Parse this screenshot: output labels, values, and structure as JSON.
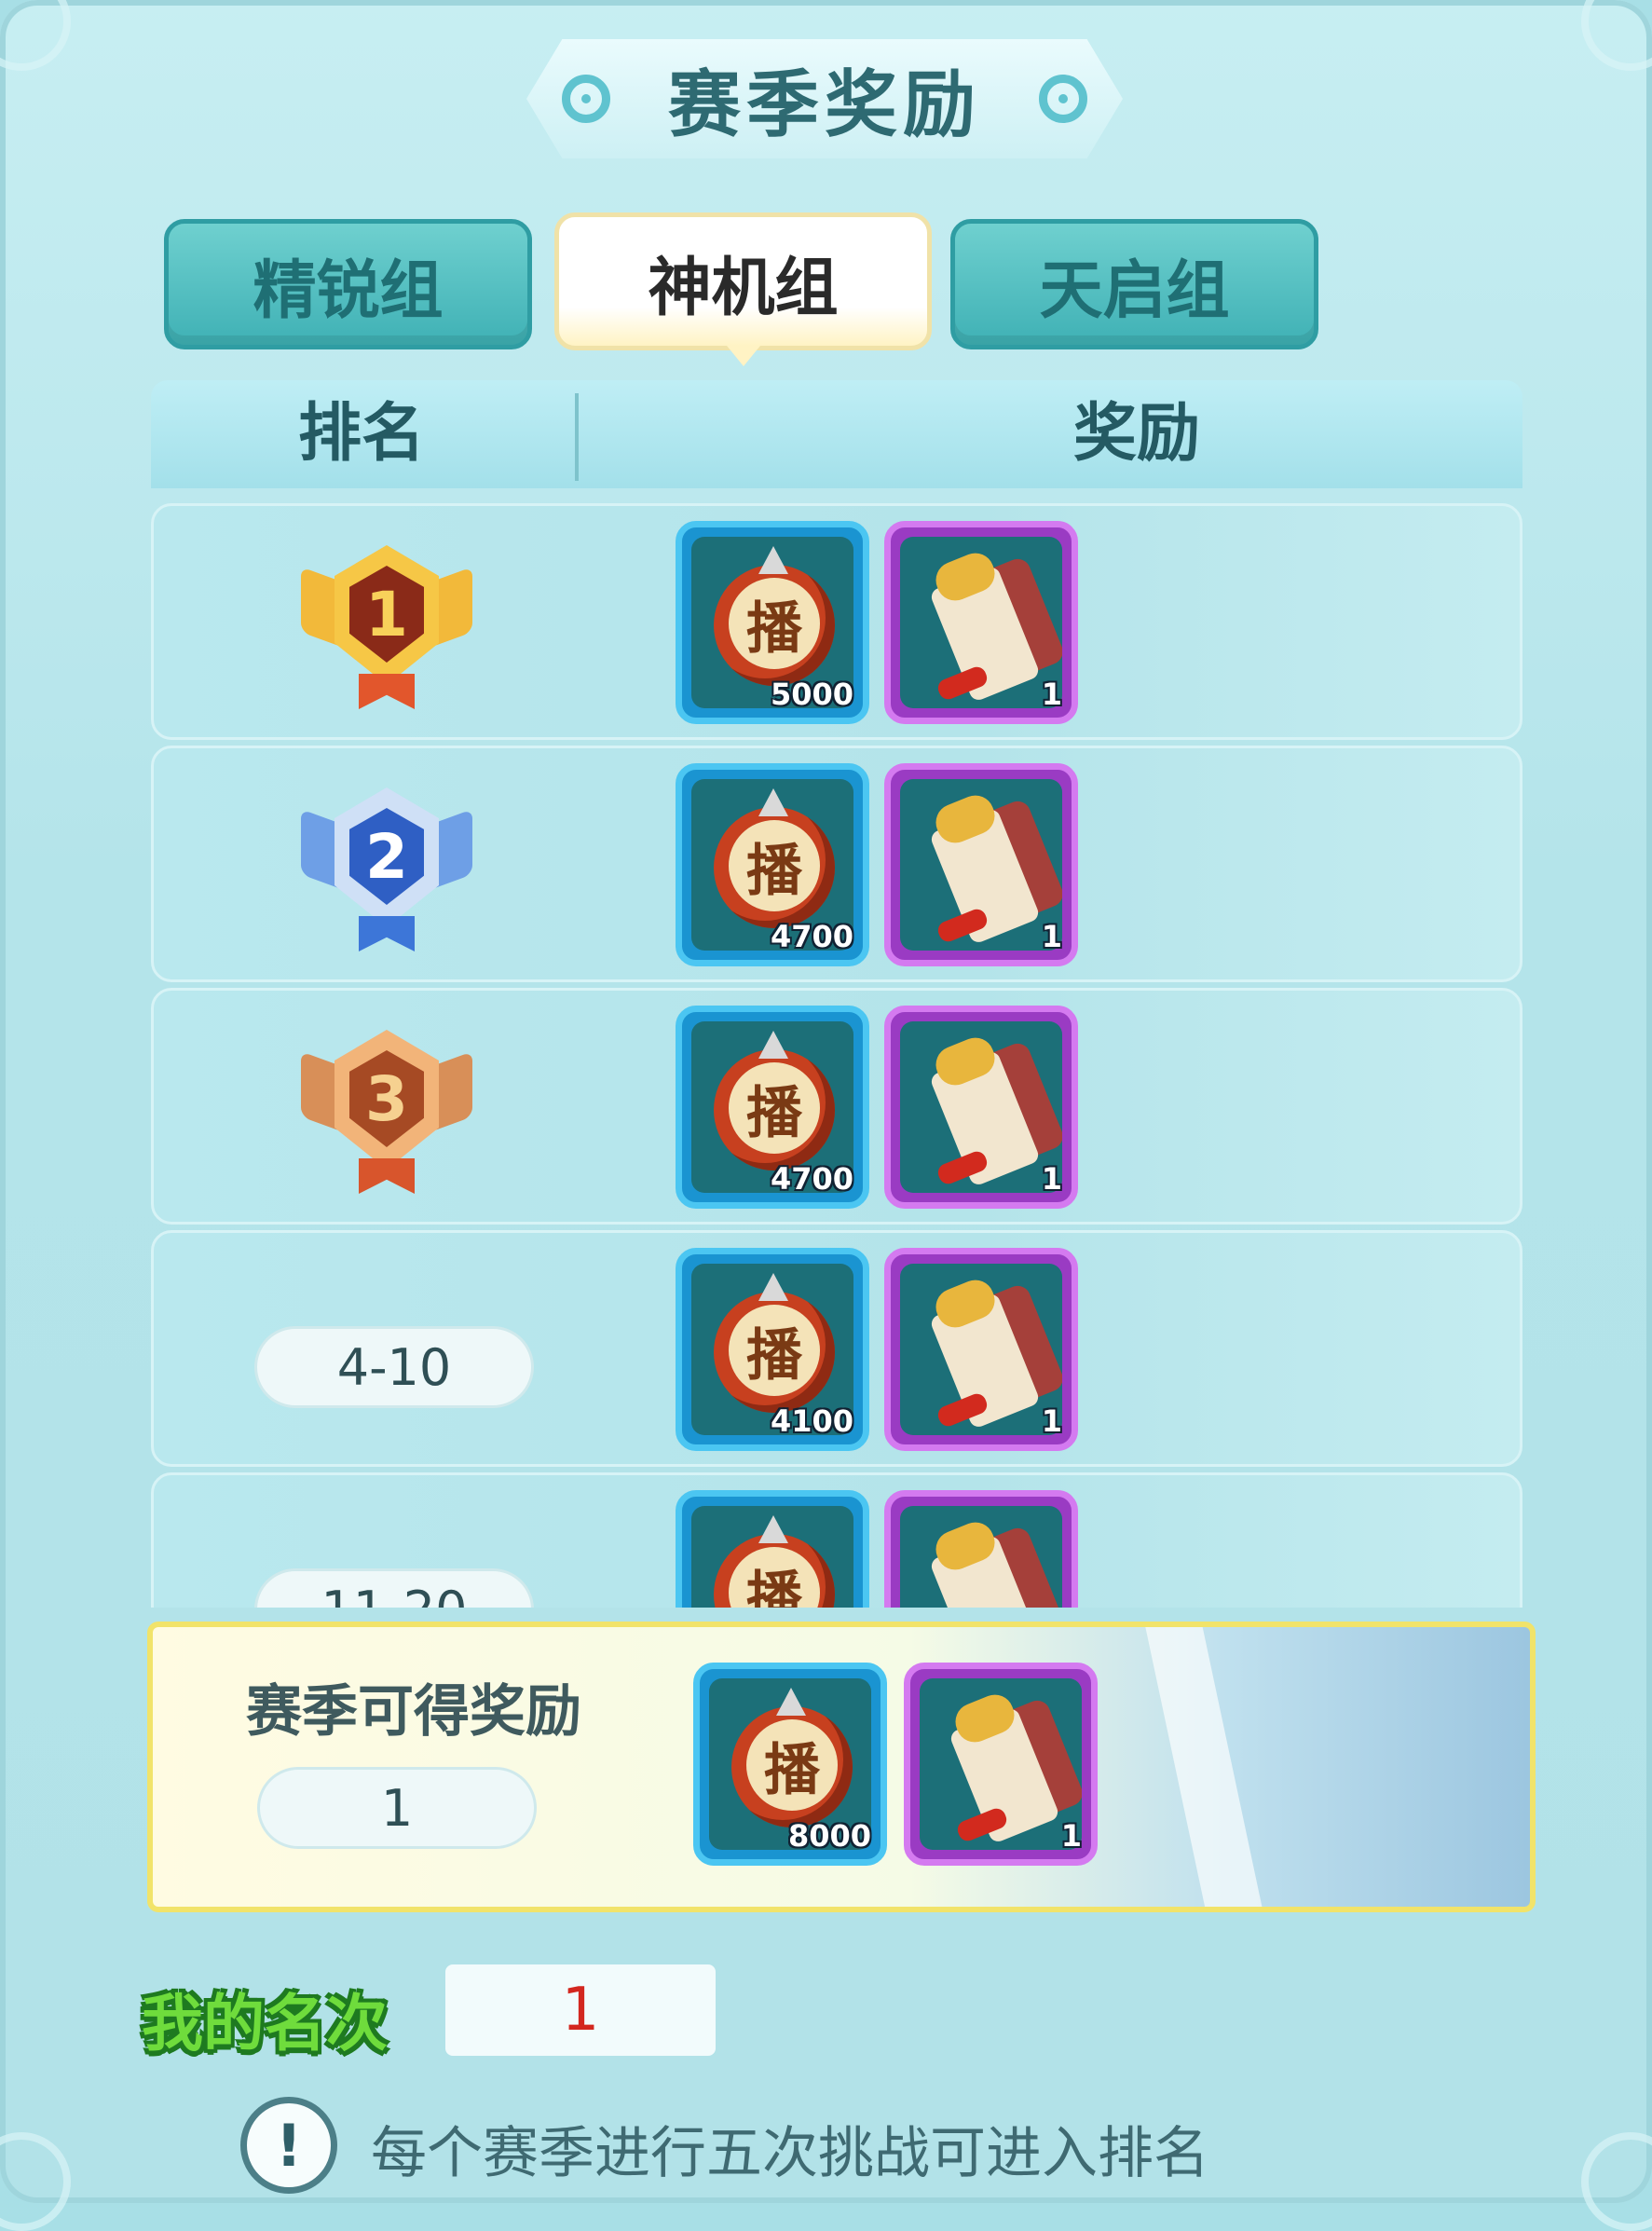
{
  "header": {
    "title": "赛季奖励"
  },
  "tabs": [
    {
      "label": "精锐组",
      "active": false
    },
    {
      "label": "神机组",
      "active": true
    },
    {
      "label": "天启组",
      "active": false
    }
  ],
  "table": {
    "col_rank": "排名",
    "col_reward": "奖励",
    "rows": [
      {
        "rank_badge": "1",
        "drum_qty": "5000",
        "scroll_qty": "1"
      },
      {
        "rank_badge": "2",
        "drum_qty": "4700",
        "scroll_qty": "1"
      },
      {
        "rank_badge": "3",
        "drum_qty": "4700",
        "scroll_qty": "1"
      },
      {
        "rank_range": "4-10",
        "drum_qty": "4100",
        "scroll_qty": "1"
      },
      {
        "rank_range": "11-20"
      }
    ],
    "item_icons": {
      "drum": "broadcast-drum-icon",
      "drum_glyph": "播",
      "scroll": "scroll-icon"
    }
  },
  "season": {
    "title": "赛季可得奖励",
    "rank_value": "1",
    "drum_qty": "8000",
    "scroll_qty": "1"
  },
  "my_rank": {
    "label": "我的名次",
    "value": "1"
  },
  "notice": {
    "icon": "!",
    "text": "每个赛季进行五次挑战可进入排名"
  },
  "colors": {
    "accent_teal": "#3fb1b5",
    "rank_value_red": "#d3271f",
    "season_border": "#f1e36a"
  }
}
